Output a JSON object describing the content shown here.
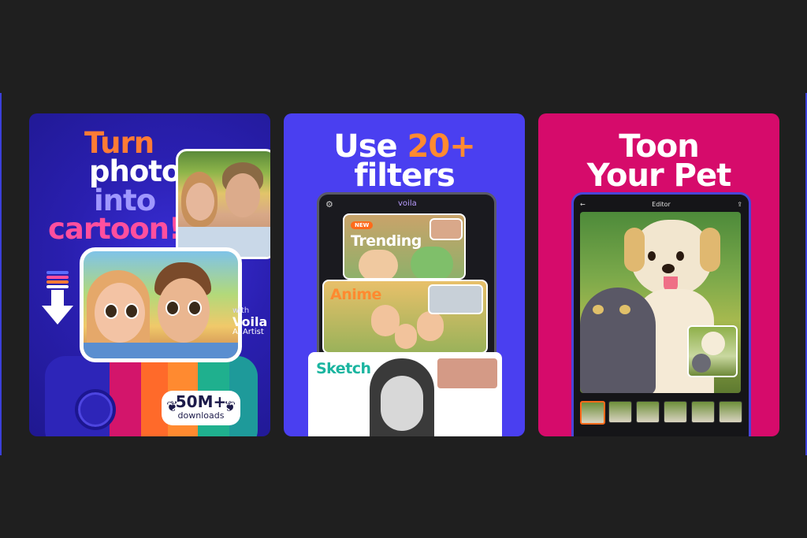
{
  "card1": {
    "headline": [
      "Turn",
      "photo",
      "into",
      "cartoon!"
    ],
    "with_label": "with",
    "brand": "Voila",
    "brand_sub": "AI Artist",
    "badge_number": "50M+",
    "badge_label": "downloads",
    "colors": {
      "line1": "#ff7b35",
      "line3": "#9f97ff",
      "line4": "#ff4f9e"
    }
  },
  "card2": {
    "headline_prefix": "Use ",
    "headline_accent": "20+",
    "headline_line2": "filters",
    "app_logo": "voila",
    "new_badge": "NEW",
    "filters": [
      "Trending",
      "Anime",
      "Sketch"
    ],
    "accent_color": "#ff8a30"
  },
  "card3": {
    "headline_line1": "Toon",
    "headline_line2": "Your Pet",
    "screen_title": "Editor",
    "icons": {
      "back": "back-arrow-icon",
      "share": "share-icon"
    }
  },
  "icons": {
    "settings": "gear-icon",
    "download": "download-arrow-icon"
  }
}
